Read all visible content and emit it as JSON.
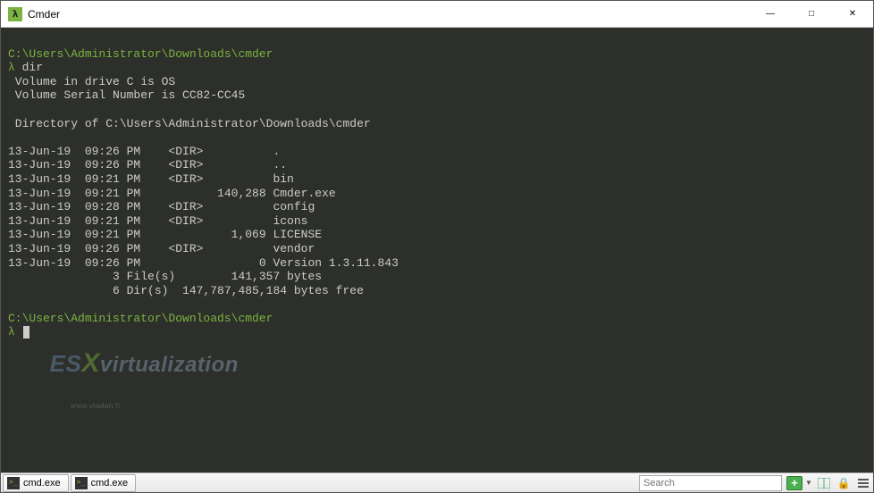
{
  "window": {
    "title": "Cmder",
    "icon_glyph": "λ"
  },
  "terminal": {
    "prompt_path": "C:\\Users\\Administrator\\Downloads\\cmder",
    "prompt_symbol": "λ",
    "command": "dir",
    "volume_line": " Volume in drive C is OS",
    "serial_line": " Volume Serial Number is CC82-CC45",
    "directory_of": " Directory of C:\\Users\\Administrator\\Downloads\\cmder",
    "rows": [
      "13-Jun-19  09:26 PM    <DIR>          .",
      "13-Jun-19  09:26 PM    <DIR>          ..",
      "13-Jun-19  09:21 PM    <DIR>          bin",
      "13-Jun-19  09:21 PM           140,288 Cmder.exe",
      "13-Jun-19  09:28 PM    <DIR>          config",
      "13-Jun-19  09:21 PM    <DIR>          icons",
      "13-Jun-19  09:21 PM             1,069 LICENSE",
      "13-Jun-19  09:26 PM    <DIR>          vendor",
      "13-Jun-19  09:26 PM                 0 Version 1.3.11.843"
    ],
    "summary_files": "               3 File(s)        141,357 bytes",
    "summary_dirs": "               6 Dir(s)  147,787,485,184 bytes free"
  },
  "watermark": {
    "text_es": "ES",
    "text_x": "X",
    "text_rest": "virtualization",
    "sub": "www.vladan.fr"
  },
  "statusbar": {
    "tabs": [
      {
        "label": "cmd.exe"
      },
      {
        "label": "cmd.exe"
      }
    ],
    "search_placeholder": "Search"
  }
}
